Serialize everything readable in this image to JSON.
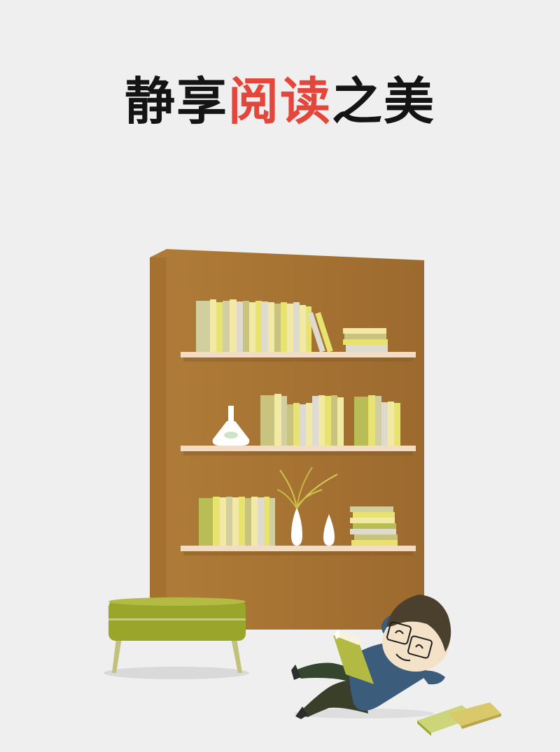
{
  "title": {
    "part1": "静享",
    "part2": "阅读",
    "part3": "之美"
  },
  "colors": {
    "background": "#efefef",
    "title_text": "#141414",
    "title_accent": "#e5463c",
    "bookshelf": "#a97635",
    "shelf_board": "#f3dcc4",
    "stool": "#9aa629",
    "book_palette": [
      "#d1cf9f",
      "#f2e9a4",
      "#e8e36f",
      "#c8c37f",
      "#dedad0",
      "#b9bd55"
    ]
  },
  "illustration": {
    "objects": [
      "bookshelf",
      "books",
      "flask-vase",
      "plant-vase",
      "small-vase",
      "stool",
      "reading-person",
      "books-on-floor"
    ]
  }
}
